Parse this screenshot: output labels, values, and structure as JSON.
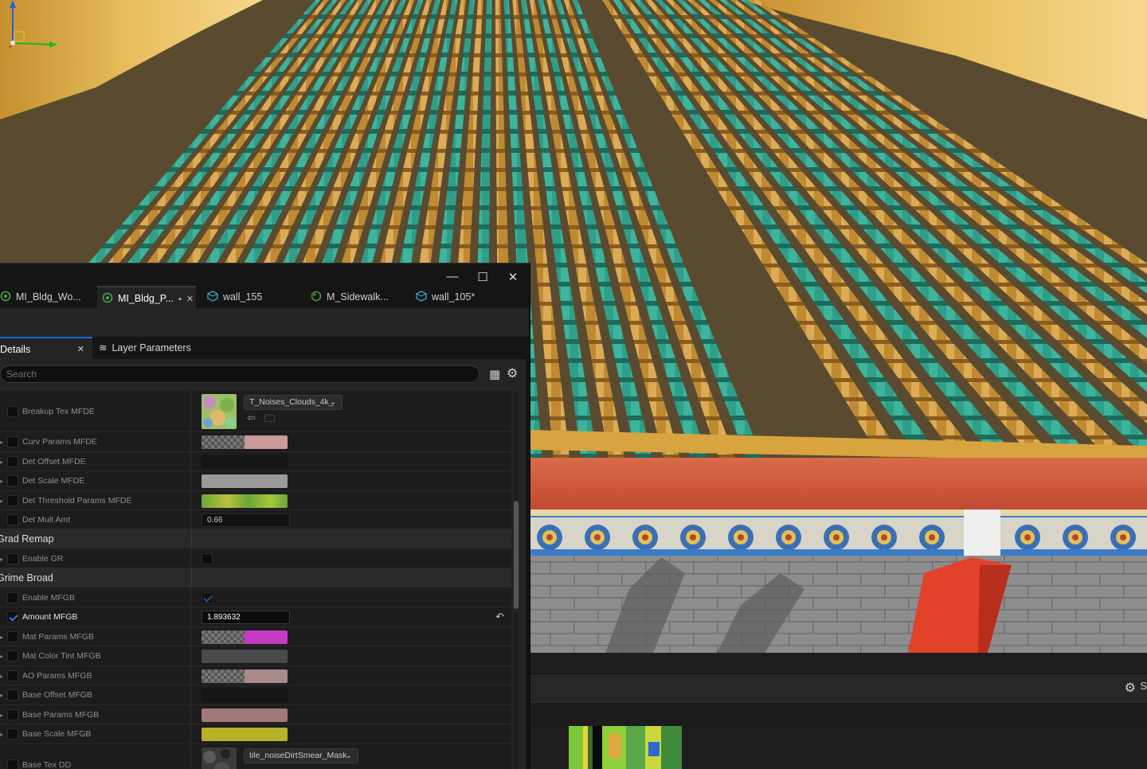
{
  "window": {
    "minimize_glyph": "—",
    "maximize_glyph": "☐",
    "close_glyph": "✕"
  },
  "doc_tabs": [
    {
      "label": "MI_Bldg_Wo...",
      "icon": "material-instance-icon",
      "active": false,
      "dirty": ""
    },
    {
      "label": "MI_Bldg_P...",
      "icon": "material-instance-icon",
      "active": true,
      "dirty": "•"
    },
    {
      "label": "wall_155",
      "icon": "static-mesh-icon",
      "active": false,
      "dirty": ""
    },
    {
      "label": "M_Sidewalk...",
      "icon": "material-icon",
      "active": false,
      "dirty": ""
    },
    {
      "label": "wall_105*",
      "icon": "static-mesh-icon",
      "active": false,
      "dirty": ""
    }
  ],
  "panels": {
    "details_label": "Details",
    "layer_params_label": "Layer Parameters"
  },
  "search": {
    "placeholder": "Search"
  },
  "rows": {
    "breakup_tex": "Breakup Tex MFDE",
    "breakup_tex_value": "T_Noises_Clouds_4k_",
    "curv_params": "Curv Params MFDE",
    "det_offset": "Det Offset MFDE",
    "det_scale": "Det Scale MFDE",
    "det_threshold": "Det Threshold Params MFDE",
    "det_mult": "Det Mult Amt",
    "det_mult_value": "0.66",
    "group_grad_remap": "Grad Remap",
    "enable_gr": "Enable GR",
    "group_grime_broad": "Grime Broad",
    "enable_mfgb": "Enable MFGB",
    "amount_mfgb": "Amount MFGB",
    "amount_mfgb_value": "1.893632",
    "mat_params": "Mat Params MFGB",
    "mat_color_tint": "Mat Color Tint MFGB",
    "ao_params": "AO Params MFGB",
    "base_offset": "Base Offset MFGB",
    "base_params": "Base Params MFGB",
    "base_scale": "Base Scale MFGB",
    "base_tex": "Base Tex DD",
    "base_tex_value": "tile_noiseDirtSmear_Mask"
  },
  "colors": {
    "accent": "#1c6dd0",
    "det_scale": "#9a9a9a",
    "mat_color_tint": "#4a4a4a",
    "base_params": "#a07878",
    "base_scale": "#b9b02a",
    "mat_params": "#c43ac4",
    "curv_params": "#c99a9a"
  },
  "lower_right": {
    "label": "S"
  }
}
